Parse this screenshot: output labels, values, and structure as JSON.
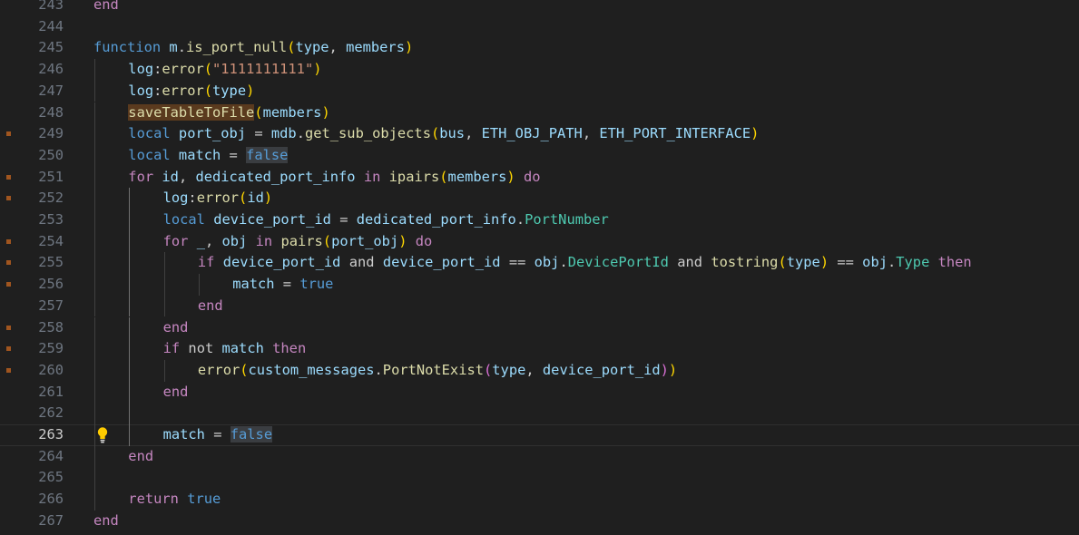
{
  "editor": {
    "colors": {
      "background": "#1f1f1f",
      "keyword_control": "#c586c0",
      "keyword_builtin": "#569cd6",
      "function": "#dcdcaa",
      "variable": "#9cdcfe",
      "string": "#ce9178",
      "constant": "#4fc1ff",
      "property": "#4ec9b0"
    },
    "current_line": 263,
    "lightbulb_icon": "lightbulb-icon",
    "lines": [
      {
        "n": "243",
        "t": [
          [
            "end",
            "kw"
          ]
        ]
      },
      {
        "n": "244",
        "t": []
      },
      {
        "n": "245",
        "t": [
          [
            "function",
            "bkw"
          ],
          [
            " ",
            "txt"
          ],
          [
            "m",
            "var"
          ],
          [
            ".",
            "txt"
          ],
          [
            "is_port_null",
            "fn"
          ],
          [
            "(",
            "p1"
          ],
          [
            "type",
            "var"
          ],
          [
            ", ",
            "txt"
          ],
          [
            "members",
            "var"
          ],
          [
            ")",
            "p1"
          ]
        ]
      },
      {
        "n": "246",
        "t": [
          [
            "log",
            "var"
          ],
          [
            ":",
            "txt"
          ],
          [
            "error",
            "fn"
          ],
          [
            "(",
            "p1"
          ],
          [
            "\"1111111111\"",
            "str"
          ],
          [
            ")",
            "p1"
          ]
        ]
      },
      {
        "n": "247",
        "t": [
          [
            "log",
            "var"
          ],
          [
            ":",
            "txt"
          ],
          [
            "error",
            "fn"
          ],
          [
            "(",
            "p1"
          ],
          [
            "type",
            "var"
          ],
          [
            ")",
            "p1"
          ]
        ]
      },
      {
        "n": "248",
        "t": [
          [
            "saveTableToFile",
            "fn hl-warn"
          ],
          [
            "(",
            "p1"
          ],
          [
            "members",
            "var"
          ],
          [
            ")",
            "p1"
          ]
        ]
      },
      {
        "n": "249",
        "t": [
          [
            "local",
            "bkw"
          ],
          [
            " ",
            "txt"
          ],
          [
            "port_obj",
            "var"
          ],
          [
            " = ",
            "txt"
          ],
          [
            "mdb",
            "var"
          ],
          [
            ".",
            "txt"
          ],
          [
            "get_sub_objects",
            "fn"
          ],
          [
            "(",
            "p1"
          ],
          [
            "bus",
            "var"
          ],
          [
            ", ",
            "txt"
          ],
          [
            "ETH_OBJ_PATH",
            "var"
          ],
          [
            ", ",
            "txt"
          ],
          [
            "ETH_PORT_INTERFACE",
            "var"
          ],
          [
            ")",
            "p1"
          ]
        ]
      },
      {
        "n": "250",
        "t": [
          [
            "local",
            "bkw"
          ],
          [
            " ",
            "txt"
          ],
          [
            "match",
            "var"
          ],
          [
            " = ",
            "txt"
          ],
          [
            "false",
            "bkw hl-sel"
          ]
        ]
      },
      {
        "n": "251",
        "t": [
          [
            "for",
            "kw"
          ],
          [
            " ",
            "txt"
          ],
          [
            "id",
            "var"
          ],
          [
            ", ",
            "txt"
          ],
          [
            "dedicated_port_info",
            "var"
          ],
          [
            " ",
            "txt"
          ],
          [
            "in",
            "kw"
          ],
          [
            " ",
            "txt"
          ],
          [
            "ipairs",
            "fn"
          ],
          [
            "(",
            "p1"
          ],
          [
            "members",
            "var"
          ],
          [
            ")",
            "p1"
          ],
          [
            " ",
            "txt"
          ],
          [
            "do",
            "kw"
          ]
        ]
      },
      {
        "n": "252",
        "t": [
          [
            "log",
            "var"
          ],
          [
            ":",
            "txt"
          ],
          [
            "error",
            "fn"
          ],
          [
            "(",
            "p1"
          ],
          [
            "id",
            "var"
          ],
          [
            ")",
            "p1"
          ]
        ]
      },
      {
        "n": "253",
        "t": [
          [
            "local",
            "bkw"
          ],
          [
            " ",
            "txt"
          ],
          [
            "device_port_id",
            "var"
          ],
          [
            " = ",
            "txt"
          ],
          [
            "dedicated_port_info",
            "var"
          ],
          [
            ".",
            "txt"
          ],
          [
            "PortNumber",
            "prop"
          ]
        ]
      },
      {
        "n": "254",
        "t": [
          [
            "for",
            "kw"
          ],
          [
            " ",
            "txt"
          ],
          [
            "_",
            "var"
          ],
          [
            ", ",
            "txt"
          ],
          [
            "obj",
            "var"
          ],
          [
            " ",
            "txt"
          ],
          [
            "in",
            "kw"
          ],
          [
            " ",
            "txt"
          ],
          [
            "pairs",
            "fn"
          ],
          [
            "(",
            "p1"
          ],
          [
            "port_obj",
            "var"
          ],
          [
            ")",
            "p1"
          ],
          [
            " ",
            "txt"
          ],
          [
            "do",
            "kw"
          ]
        ]
      },
      {
        "n": "255",
        "t": [
          [
            "if",
            "kw"
          ],
          [
            " ",
            "txt"
          ],
          [
            "device_port_id",
            "var"
          ],
          [
            " ",
            "txt"
          ],
          [
            "and",
            "txt"
          ],
          [
            " ",
            "txt"
          ],
          [
            "device_port_id",
            "var"
          ],
          [
            " == ",
            "txt"
          ],
          [
            "obj",
            "var"
          ],
          [
            ".",
            "txt"
          ],
          [
            "DevicePortId",
            "prop"
          ],
          [
            " ",
            "txt"
          ],
          [
            "and",
            "txt"
          ],
          [
            " ",
            "txt"
          ],
          [
            "tostring",
            "fn"
          ],
          [
            "(",
            "p1"
          ],
          [
            "type",
            "var"
          ],
          [
            ")",
            "p1"
          ],
          [
            " == ",
            "txt"
          ],
          [
            "obj",
            "var"
          ],
          [
            ".",
            "txt"
          ],
          [
            "Type",
            "prop"
          ],
          [
            " ",
            "txt"
          ],
          [
            "then",
            "kw"
          ]
        ]
      },
      {
        "n": "256",
        "t": [
          [
            "match",
            "var"
          ],
          [
            " = ",
            "txt"
          ],
          [
            "true",
            "bkw"
          ]
        ]
      },
      {
        "n": "257",
        "t": [
          [
            "end",
            "kw"
          ]
        ]
      },
      {
        "n": "258",
        "t": [
          [
            "end",
            "kw"
          ]
        ]
      },
      {
        "n": "259",
        "t": [
          [
            "if",
            "kw"
          ],
          [
            " ",
            "txt"
          ],
          [
            "not",
            "txt"
          ],
          [
            " ",
            "txt"
          ],
          [
            "match",
            "var"
          ],
          [
            " ",
            "txt"
          ],
          [
            "then",
            "kw"
          ]
        ]
      },
      {
        "n": "260",
        "t": [
          [
            "error",
            "fn"
          ],
          [
            "(",
            "p1"
          ],
          [
            "custom_messages",
            "var"
          ],
          [
            ".",
            "txt"
          ],
          [
            "PortNotExist",
            "fn"
          ],
          [
            "(",
            "p2"
          ],
          [
            "type",
            "var"
          ],
          [
            ", ",
            "txt"
          ],
          [
            "device_port_id",
            "var"
          ],
          [
            ")",
            "p2"
          ],
          [
            ")",
            "p1"
          ]
        ]
      },
      {
        "n": "261",
        "t": [
          [
            "end",
            "kw"
          ]
        ]
      },
      {
        "n": "262",
        "t": []
      },
      {
        "n": "263",
        "t": [
          [
            "match",
            "var"
          ],
          [
            " = ",
            "txt"
          ],
          [
            "false",
            "bkw hl-sel"
          ]
        ]
      },
      {
        "n": "264",
        "t": [
          [
            "end",
            "kw"
          ]
        ]
      },
      {
        "n": "265",
        "t": []
      },
      {
        "n": "266",
        "t": [
          [
            "return",
            "kw"
          ],
          [
            " ",
            "txt"
          ],
          [
            "true",
            "bkw"
          ]
        ]
      },
      {
        "n": "267",
        "t": [
          [
            "end",
            "kw"
          ]
        ]
      }
    ]
  }
}
